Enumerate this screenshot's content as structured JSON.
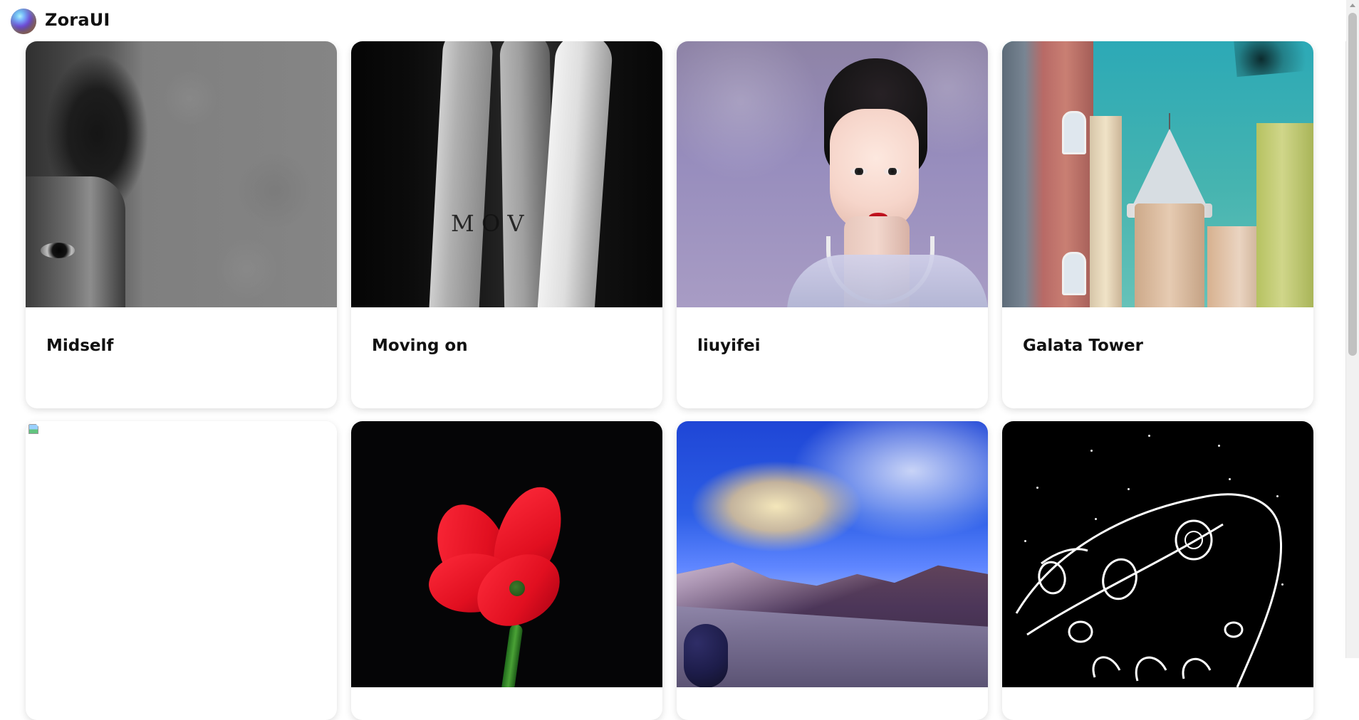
{
  "header": {
    "brand": "ZoraUI"
  },
  "gallery": {
    "row1": [
      {
        "title": "Midself"
      },
      {
        "title": "Moving on",
        "tattoo_text": "M O V"
      },
      {
        "title": "liuyifei"
      },
      {
        "title": "Galata Tower"
      }
    ],
    "row2": [
      {
        "image_state": "broken"
      },
      {
        "image_state": "loaded"
      },
      {
        "image_state": "loaded"
      },
      {
        "image_state": "loaded"
      }
    ]
  },
  "icons": {
    "logo": "logo-orb-icon",
    "broken_image": "broken-image-icon"
  },
  "colors": {
    "background": "#ffffff",
    "text": "#111111",
    "card_shadow": "rgba(0,0,0,0.13)"
  }
}
